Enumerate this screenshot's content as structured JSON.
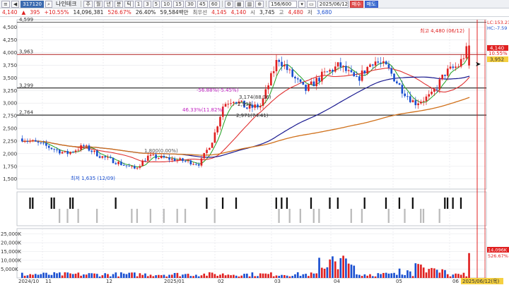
{
  "toolbar": {
    "code": "317120",
    "stock_name": "나인테크",
    "periods": [
      "주",
      "월",
      "년",
      "분",
      "틱"
    ],
    "intervals": [
      "1",
      "3",
      "5",
      "10",
      "15",
      "30",
      "45",
      "60"
    ],
    "page_counter": "156/600",
    "date": "2025/06/12",
    "buy_label": "매수",
    "sell_label": "매도",
    "settings_label": "⚙"
  },
  "quote": {
    "price": "4,140",
    "change": "395",
    "change_pct": "+10.55%",
    "volume": "14,096,381",
    "vol_ratio": "526.67%",
    "turnover": "26.40%",
    "amount": "59,584백만",
    "first_label": "최우선",
    "ask": "4,145",
    "bid": "4,140",
    "open_label": "시",
    "open": "3,745",
    "high_label": "고",
    "high": "4,480",
    "low_label": "저",
    "low": "3,680"
  },
  "price_panel": {
    "y_ticks": [
      "4,500",
      "4,250",
      "4,000",
      "3,750",
      "3,500",
      "3,250",
      "3,000",
      "2,750",
      "2,500",
      "2,250",
      "2,000",
      "1,750",
      "1,500"
    ],
    "left_levels": [
      "4,599",
      "3,963",
      "3,299",
      "2,764"
    ],
    "right_tags": {
      "lc": "LC:153.21",
      "hc": "HC:-7.59",
      "price": "4,140",
      "pct": "10.55%",
      "prev": "3,952"
    },
    "annotations": {
      "high": "최고 4,480 (06/12)",
      "low": "최저 1,635 (12/09)",
      "pct1": "-56.88%(-5.45%)",
      "pct2": "46.33%(11.82%)",
      "p1": "3,174(88.36)",
      "p2": "2,971(74.41)",
      "small": "2,998",
      "sideline": "1,800(0.00%)"
    }
  },
  "volume_panel": {
    "y_ticks": [
      "25,000K",
      "20,000K",
      "15,000K",
      "10,000K",
      "5,000K"
    ],
    "right_tags": {
      "current": "14,096K",
      "ratio": "526.67%"
    }
  },
  "x_axis": {
    "labels": [
      "2024/10",
      "11",
      "12",
      "2025/01",
      "02",
      "03",
      "04",
      "05",
      "06"
    ],
    "cursor_date": "2025/06/12(목)"
  },
  "colors": {
    "up": "#e02020",
    "down": "#1a4fd0",
    "ma_short": "#e03030",
    "ma_mid": "#1a1a90",
    "ma_long": "#d0701a",
    "ma_green": "#20a020",
    "level_line": "#000000",
    "cursor_line": "#e02020"
  },
  "chart_data": {
    "type": "candlestick",
    "x_labels": [
      "2024/10",
      "11",
      "12",
      "2025/01",
      "02",
      "03",
      "04",
      "05",
      "06"
    ],
    "ylim": [
      1300,
      4650
    ],
    "volume_ylim": [
      0,
      28000
    ],
    "volume_unit": "K",
    "horizontal_levels": [
      4599,
      3963,
      3299,
      2764
    ],
    "last": {
      "date": "2025/06/12",
      "open": 3745,
      "high": 4480,
      "low": 3680,
      "close": 4140,
      "volume_k": 14096
    },
    "extremes": {
      "high": {
        "value": 4480,
        "date": "06/12"
      },
      "low": {
        "value": 1635,
        "date": "12/09"
      }
    }
  }
}
